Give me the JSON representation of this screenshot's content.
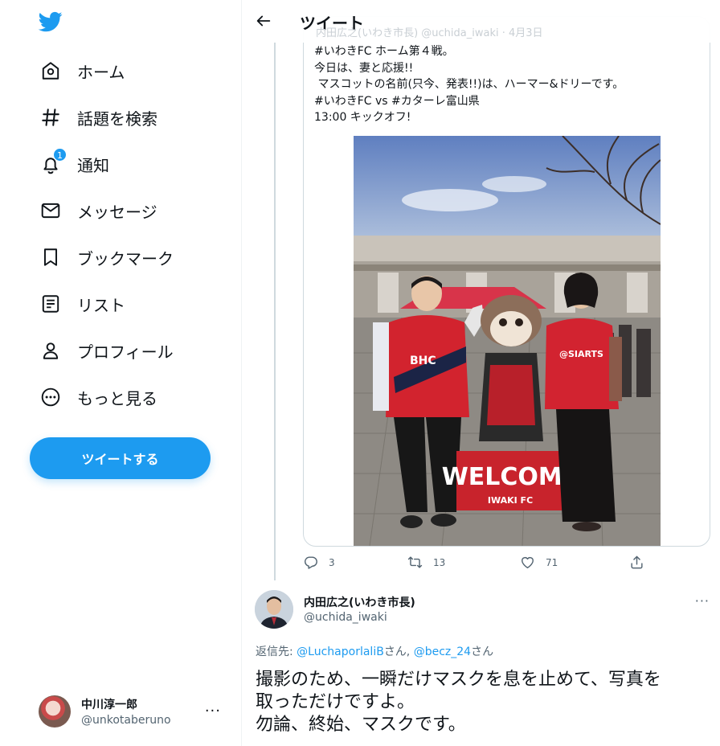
{
  "sidebar": {
    "items": [
      {
        "label": "ホーム",
        "icon": "home-icon"
      },
      {
        "label": "話題を検索",
        "icon": "hashtag-icon"
      },
      {
        "label": "通知",
        "icon": "bell-icon",
        "badge": "1"
      },
      {
        "label": "メッセージ",
        "icon": "envelope-icon"
      },
      {
        "label": "ブックマーク",
        "icon": "bookmark-icon"
      },
      {
        "label": "リスト",
        "icon": "list-icon"
      },
      {
        "label": "プロフィール",
        "icon": "person-icon"
      },
      {
        "label": "もっと見る",
        "icon": "more-circle-icon"
      }
    ],
    "tweet_button": "ツイートする",
    "account": {
      "name": "中川淳一郎",
      "handle": "@unkotaberuno",
      "more": "···"
    }
  },
  "header": {
    "title": "ツイート",
    "ghost_text": "内田広之(いわき市長) @uchida_iwaki · 4月3日"
  },
  "quoted_tweet": {
    "text": "#いわきFC ホーム第４戦。\n今日は、妻と応援!!\n マスコットの名前(只今、発表!!)は、ハーマー&ドリーです。\n#いわきFC vs #カターレ富山県\n13:00 キックオフ!",
    "photo_banner": "WELCOME",
    "photo_banner_sub": "IWAKI FC",
    "actions": {
      "replies": "3",
      "retweets": "13",
      "likes": "71"
    }
  },
  "reply": {
    "name": "内田広之(いわき市長)",
    "handle": "@uchida_iwaki",
    "more": "···",
    "replying_prefix": "返信先: ",
    "mention1": "@LuchaporlaliB",
    "san1": "さん, ",
    "mention2": "@becz_24",
    "san2": "さん",
    "text": "撮影のため、一瞬だけマスクを息を止めて、写真を\n取っただけですよ。\n勿論、終始、マスクです。"
  },
  "colors": {
    "accent": "#1d9bf0",
    "text": "#0f1419",
    "secondary": "#536471",
    "border": "#cfd9de"
  }
}
